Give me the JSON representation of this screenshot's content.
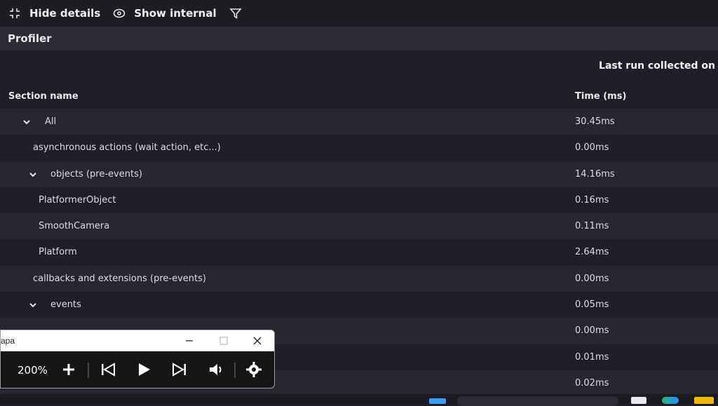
{
  "toolbar": {
    "hide_details": "Hide details",
    "show_internal": "Show internal",
    "icons": {
      "hide": "collapse-icon",
      "show": "eye-icon",
      "filter": "filter-icon"
    }
  },
  "profiler": {
    "title": "Profiler",
    "last_run": "Last run collected on"
  },
  "table": {
    "headers": {
      "section": "Section name",
      "time": "Time (ms)"
    },
    "rows": [
      {
        "name": "All",
        "time": "30.45ms",
        "expanded": true
      },
      {
        "name": "asynchronous actions (wait action, etc...)",
        "time": "0.00ms"
      },
      {
        "name": "objects (pre-events)",
        "time": "14.16ms",
        "expanded": true
      },
      {
        "name": "PlatformerObject",
        "time": "0.16ms"
      },
      {
        "name": "SmoothCamera",
        "time": "0.11ms"
      },
      {
        "name": "Platform",
        "time": "2.64ms"
      },
      {
        "name": "callbacks and extensions (pre-events)",
        "time": "0.00ms"
      },
      {
        "name": "events",
        "time": "0.05ms",
        "expanded": true
      },
      {
        "name": "",
        "time": "0.00ms"
      },
      {
        "name": "",
        "time": "0.01ms"
      },
      {
        "name": "",
        "time": "0.02ms"
      }
    ]
  },
  "player": {
    "title": "apa",
    "zoom": "200%",
    "icons": [
      "plus-icon",
      "skip-back-icon",
      "play-icon",
      "skip-forward-icon",
      "volume-icon",
      "gear-icon"
    ]
  },
  "colors": {
    "background": "#1f1f27",
    "header": "#2b2b34",
    "alt_row": "#272730",
    "text": "#e6e6ea"
  }
}
